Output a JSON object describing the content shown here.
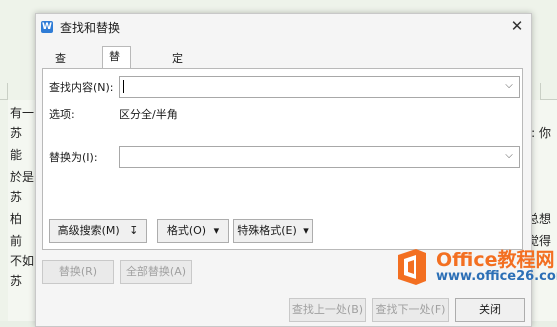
{
  "document": {
    "left_lines": [
      "有一",
      "苏",
      "能",
      "於是",
      "苏",
      "柏",
      "前",
      "不如",
      "苏"
    ],
    "right_lines": [
      ": 你",
      "总想",
      "觉得"
    ]
  },
  "dialog": {
    "title": "查找和替换",
    "close_label": "✕",
    "tabs": [
      {
        "label": "查找(D)",
        "active": false
      },
      {
        "label": "替换(P)",
        "active": true
      },
      {
        "label": "定位(G)",
        "active": false
      }
    ],
    "find": {
      "label": "查找内容(N):",
      "value": ""
    },
    "options": {
      "label": "选项:",
      "value": "区分全/半角"
    },
    "replace": {
      "label": "替换为(I):",
      "value": ""
    },
    "panel_buttons": {
      "advanced": "高级搜索(M)",
      "advanced_arrow": "↧",
      "format": "格式(O)",
      "special": "特殊格式(E)",
      "dropdown_arrow": "▾"
    },
    "action_buttons": {
      "replace": "替换(R)",
      "replace_all": "全部替换(A)",
      "find_prev": "查找上一处(B)",
      "find_next": "查找下一处(F)",
      "close": "关闭"
    }
  },
  "watermark": {
    "brand": "Office教程网",
    "url": "www.office26.com",
    "colors": {
      "orange": "#f36f21",
      "blue": "#2c6fb6"
    }
  }
}
